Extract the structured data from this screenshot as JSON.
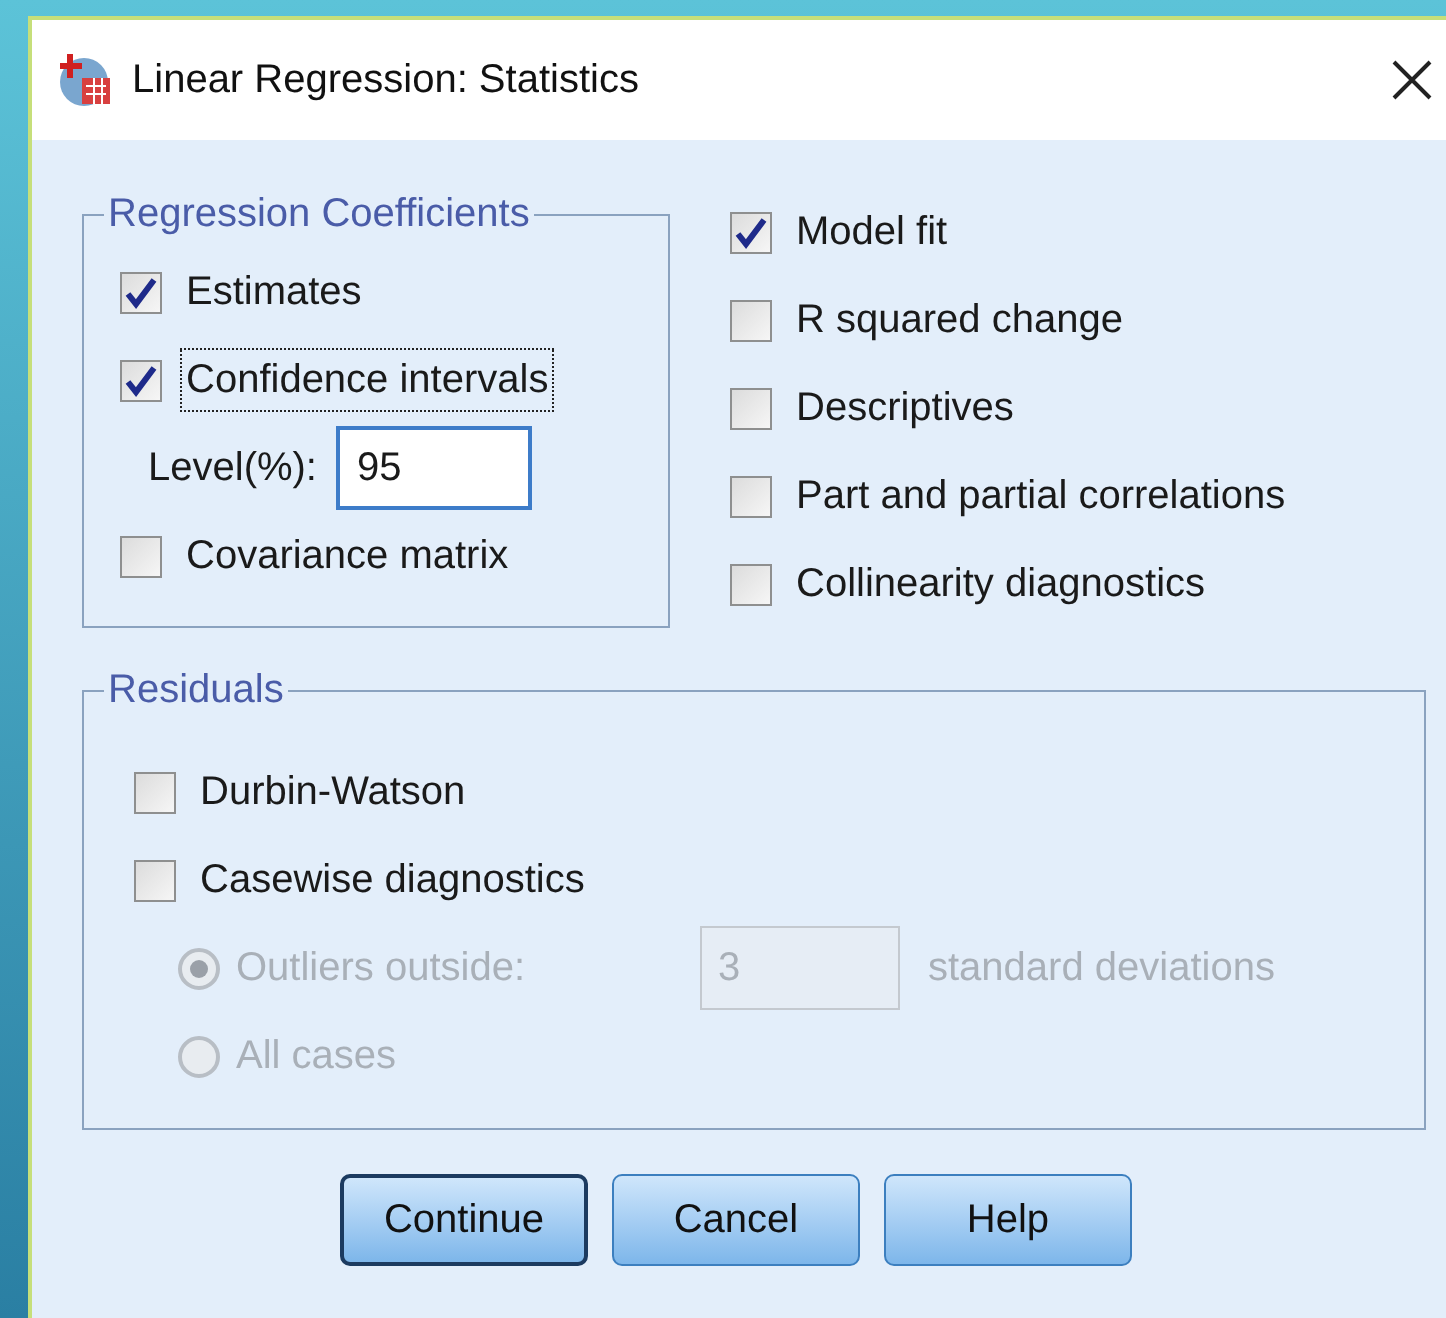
{
  "window": {
    "title": "Linear Regression: Statistics"
  },
  "regression_coefficients": {
    "title": "Regression Coefficients",
    "options": [
      {
        "kind": "checkbox",
        "label": "Estimates",
        "checked": true,
        "focused": false
      },
      {
        "kind": "checkbox",
        "label": "Confidence intervals",
        "checked": true,
        "focused": true
      },
      {
        "kind": "field",
        "label": "Level(%):",
        "value": "95"
      },
      {
        "kind": "checkbox",
        "label": "Covariance matrix",
        "checked": false,
        "focused": false
      }
    ]
  },
  "model_options": [
    {
      "label": "Model fit",
      "checked": true
    },
    {
      "label": "R squared change",
      "checked": false
    },
    {
      "label": "Descriptives",
      "checked": false
    },
    {
      "label": "Part and partial correlations",
      "checked": false
    },
    {
      "label": "Collinearity diagnostics",
      "checked": false
    }
  ],
  "residuals": {
    "title": "Residuals",
    "options": [
      {
        "label": "Durbin-Watson",
        "checked": false
      },
      {
        "label": "Casewise diagnostics",
        "checked": false
      }
    ],
    "casewise_radios": [
      {
        "label": "Outliers outside:",
        "selected": true,
        "disabled": true,
        "value": "3",
        "suffix": "standard deviations"
      },
      {
        "label": "All cases",
        "selected": false,
        "disabled": true
      }
    ]
  },
  "buttons": [
    {
      "label": "Continue",
      "default": true
    },
    {
      "label": "Cancel",
      "default": false
    },
    {
      "label": "Help",
      "default": false
    }
  ]
}
